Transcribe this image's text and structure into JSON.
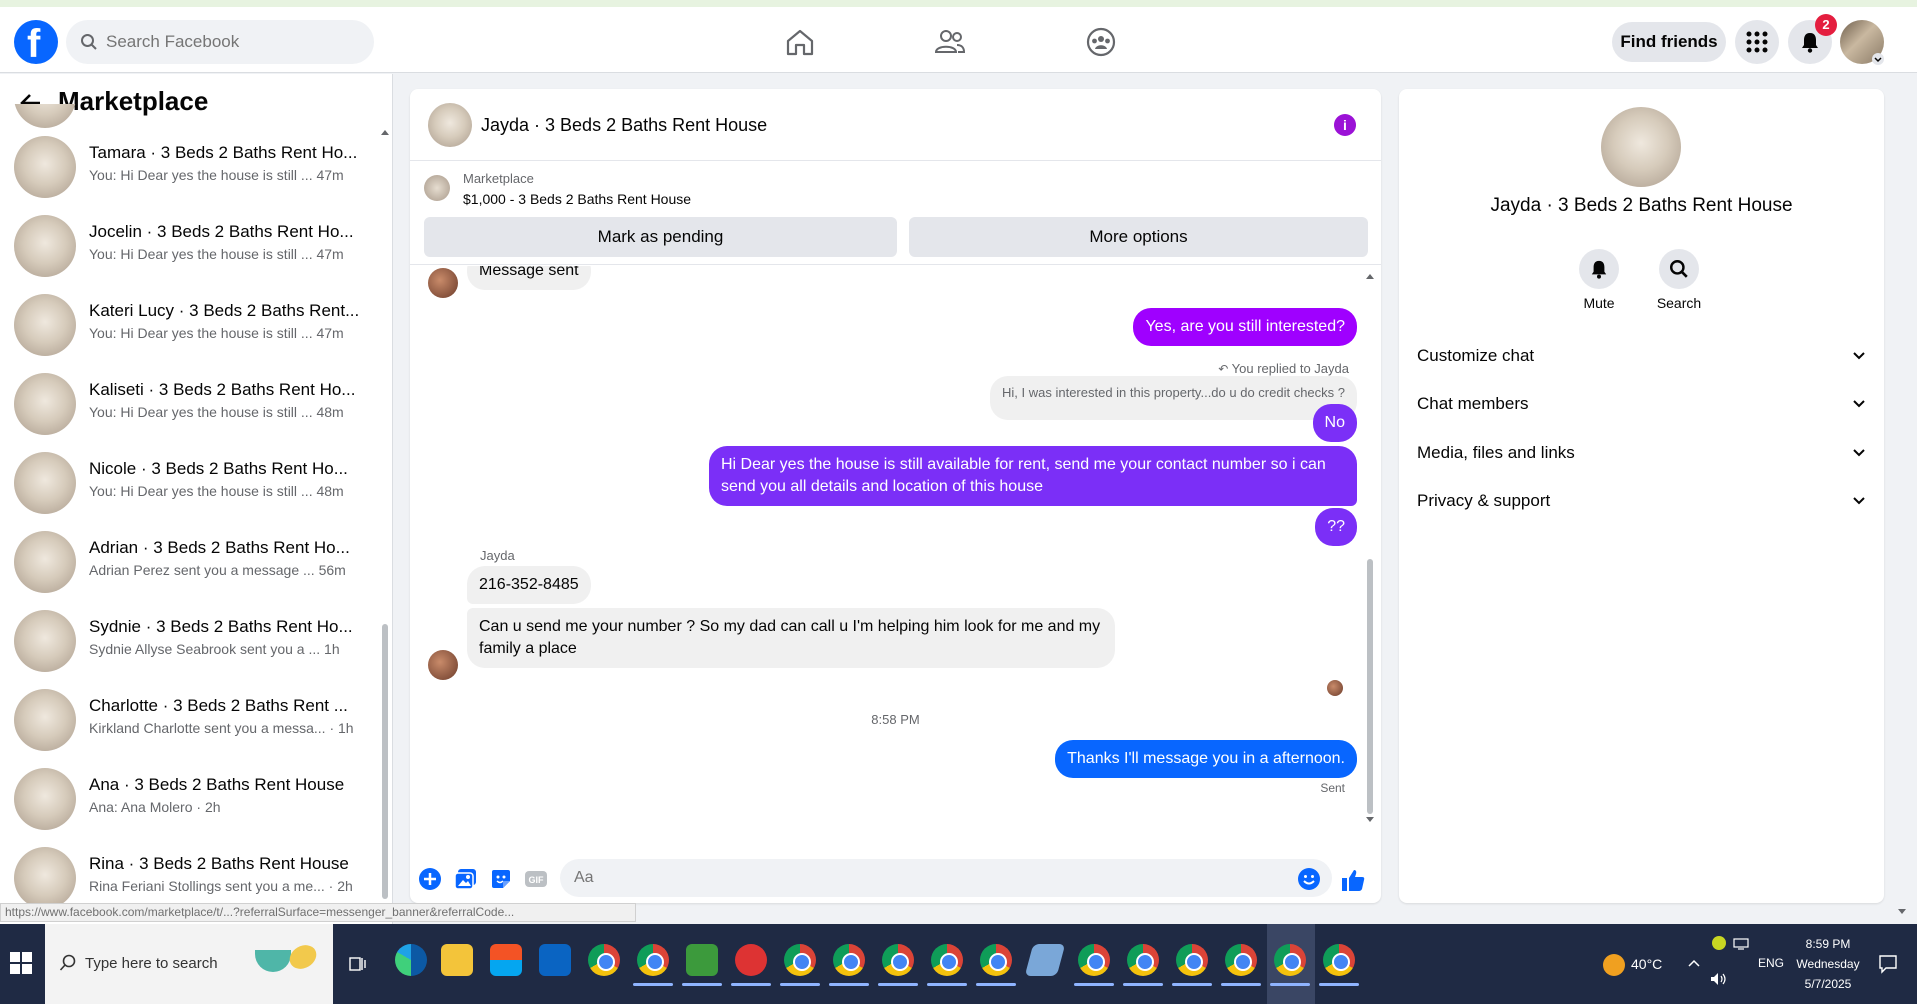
{
  "topbar": {
    "search_placeholder": "Search Facebook",
    "find_friends": "Find friends",
    "notif_count": "2"
  },
  "sidebar": {
    "title": "Marketplace",
    "conversations": [
      {
        "name": "Tamara · 3 Beds 2 Baths Rent Ho...",
        "preview": "You: Hi Dear yes the house is still ...  47m"
      },
      {
        "name": "Jocelin · 3 Beds 2 Baths Rent Ho...",
        "preview": "You: Hi Dear yes the house is still ...  47m"
      },
      {
        "name": "Kateri Lucy · 3 Beds 2 Baths Rent...",
        "preview": "You: Hi Dear yes the house is still ...  47m"
      },
      {
        "name": "Kaliseti · 3 Beds 2 Baths Rent Ho...",
        "preview": "You: Hi Dear yes the house is still ...  48m"
      },
      {
        "name": "Nicole · 3 Beds 2 Baths Rent Ho...",
        "preview": "You: Hi Dear yes the house is still ...  48m"
      },
      {
        "name": "Adrian · 3 Beds 2 Baths Rent Ho...",
        "preview": "Adrian Perez sent you a message ...  56m"
      },
      {
        "name": "Sydnie · 3 Beds 2 Baths Rent Ho...",
        "preview": "Sydnie Allyse Seabrook sent you a ...  1h"
      },
      {
        "name": "Charlotte · 3 Beds 2 Baths Rent ...",
        "preview": "Kirkland Charlotte sent you a messa... · 1h"
      },
      {
        "name": "Ana · 3 Beds 2 Baths Rent House",
        "preview": "Ana: Ana Molero · 2h"
      },
      {
        "name": "Rina · 3 Beds 2 Baths Rent House",
        "preview": "Rina Feriani Stollings sent you a me... · 2h"
      }
    ]
  },
  "chat": {
    "title": "Jayda · 3 Beds 2 Baths Rent House",
    "listing_category": "Marketplace",
    "listing_price": "$1,000 - 3 Beds 2 Baths Rent House",
    "mark_pending": "Mark as pending",
    "more_options": "More options",
    "partial_msg": "Message sent",
    "msg1": "Yes, are you still interested?",
    "replied_label": "You replied to Jayda",
    "quoted": "Hi, I was interested in this property...do u do credit checks ?",
    "msg_no": "No",
    "msg_long": "Hi Dear yes the house is still available for rent, send me your contact number so i can send you all details and location of this house",
    "msg_q": "??",
    "sender": "Jayda",
    "in1": "216-352-8485",
    "in2": "Can u send me your number ? So my dad can call u I'm helping him look for me and my family a place",
    "time": "8:58 PM",
    "msg_last": "Thanks I'll message you in a afternoon.",
    "sent_label": "Sent",
    "input_placeholder": "Aa"
  },
  "rpanel": {
    "title": "Jayda · 3 Beds 2 Baths Rent House",
    "mute": "Mute",
    "search": "Search",
    "rows": [
      "Customize chat",
      "Chat members",
      "Media, files and links",
      "Privacy & support"
    ]
  },
  "status_url": "https://www.facebook.com/marketplace/t/...?referralSurface=messenger_banner&referralCode...",
  "taskbar": {
    "search_placeholder": "Type here to search",
    "temp": "40°C",
    "lang": "ENG",
    "time": "8:59 PM",
    "day": "Wednesday",
    "date": "5/7/2025"
  },
  "colors": {
    "fb_blue": "#0866ff",
    "purple": "#9f00ff",
    "violet": "#7b2ff7"
  }
}
